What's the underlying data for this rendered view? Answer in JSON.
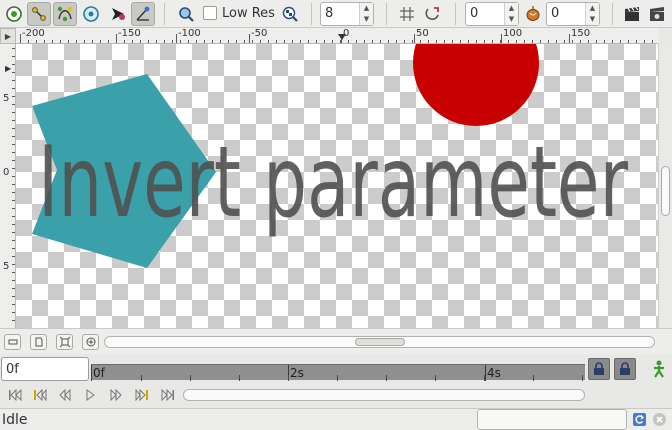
{
  "toolbar": {
    "low_res_label": "Low Res",
    "low_res_checked": false,
    "quality_value": "8",
    "onion_past_value": "0",
    "onion_future_value": "0"
  },
  "ruler": {
    "h_labels": [
      "-200",
      "-150",
      "-100",
      "-50",
      "0",
      "50",
      "100",
      "150"
    ],
    "v_labels": [
      "5",
      "0",
      "5"
    ]
  },
  "canvas": {
    "text_layer": "Invert parameter",
    "colors": {
      "star": "#3aa0aa",
      "circle": "#c80000",
      "text": "#505050"
    }
  },
  "timebar": {
    "current_time": "0f",
    "labels": [
      "0f",
      "2s",
      "4s"
    ]
  },
  "status": {
    "text": "Idle"
  },
  "accent": "#e0a000"
}
